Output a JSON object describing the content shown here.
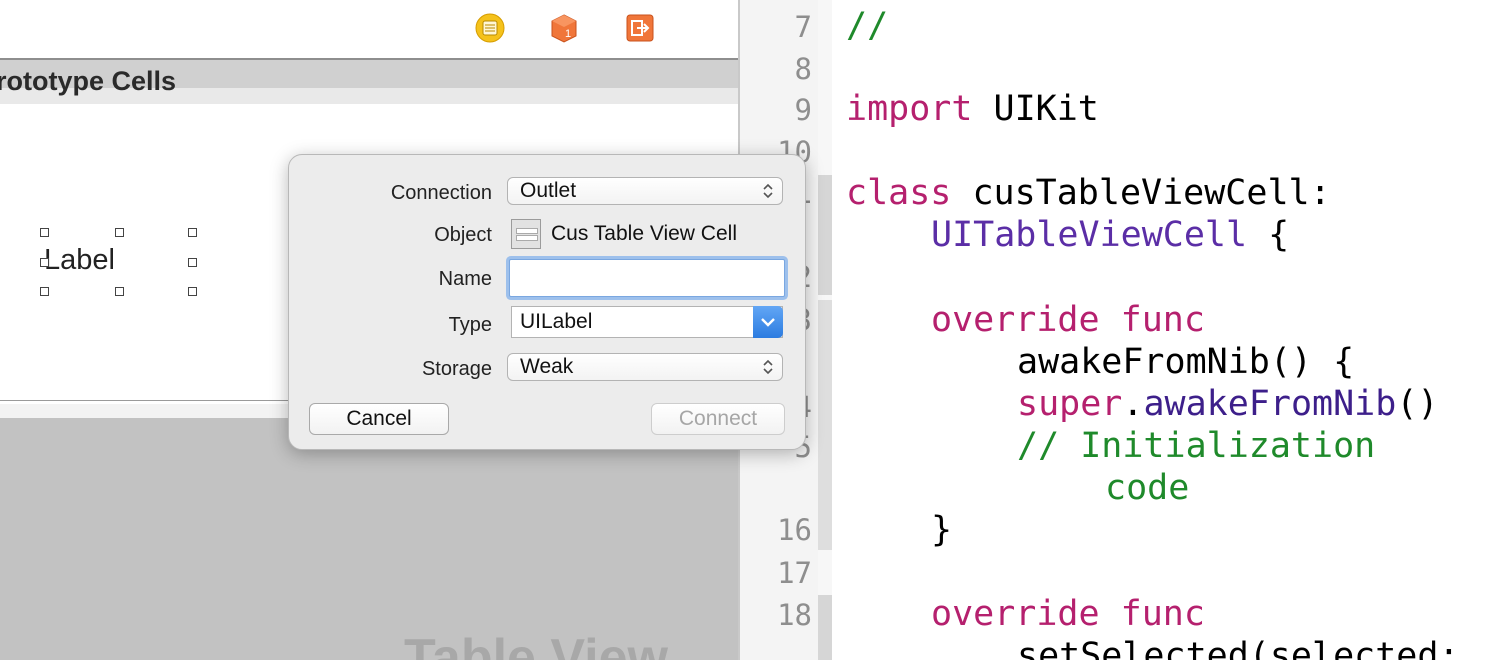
{
  "storyboard": {
    "section_header": "rototype Cells",
    "cell_label": "Label",
    "watermark": "Table View",
    "toolbar_icons": [
      "view-controller-icon",
      "first-responder-icon",
      "exit-icon"
    ]
  },
  "popover": {
    "connection": {
      "label": "Connection",
      "value": "Outlet"
    },
    "object": {
      "label": "Object",
      "value": "Cus Table View Cell"
    },
    "name": {
      "label": "Name",
      "value": ""
    },
    "type": {
      "label": "Type",
      "value": "UILabel"
    },
    "storage": {
      "label": "Storage",
      "value": "Weak"
    },
    "cancel_label": "Cancel",
    "connect_label": "Connect"
  },
  "editor": {
    "line_numbers": [
      "7",
      "8",
      "9",
      "10",
      "1",
      "2",
      "3",
      "4",
      "5",
      "16",
      "17",
      "18"
    ],
    "code": {
      "l7_comment": "//",
      "l9_import_kw": "import",
      "l9_module": "UIKit",
      "l11_class_kw": "class",
      "l11_name": "cusTableViewCell:",
      "l11b_super": "UITableViewCell",
      "l11b_brace": "{",
      "l13_override": "override",
      "l13_func": "func",
      "l13b_name": "awakeFromNib() {",
      "l14_super": "super",
      "l14_dot": ".",
      "l14_call": "awakeFromNib",
      "l14_parens": "()",
      "l15_comment": "// Initialization",
      "l15b_comment": "code",
      "l16_brace": "}",
      "l18_override": "override",
      "l18_func": "func",
      "l18b_name": "setSelected(selected:"
    }
  },
  "colors": {
    "keyword": "#b5206e",
    "type": "#5b2ea6",
    "comment": "#1f8a2b",
    "selection_blue": "#2c7ce0"
  }
}
